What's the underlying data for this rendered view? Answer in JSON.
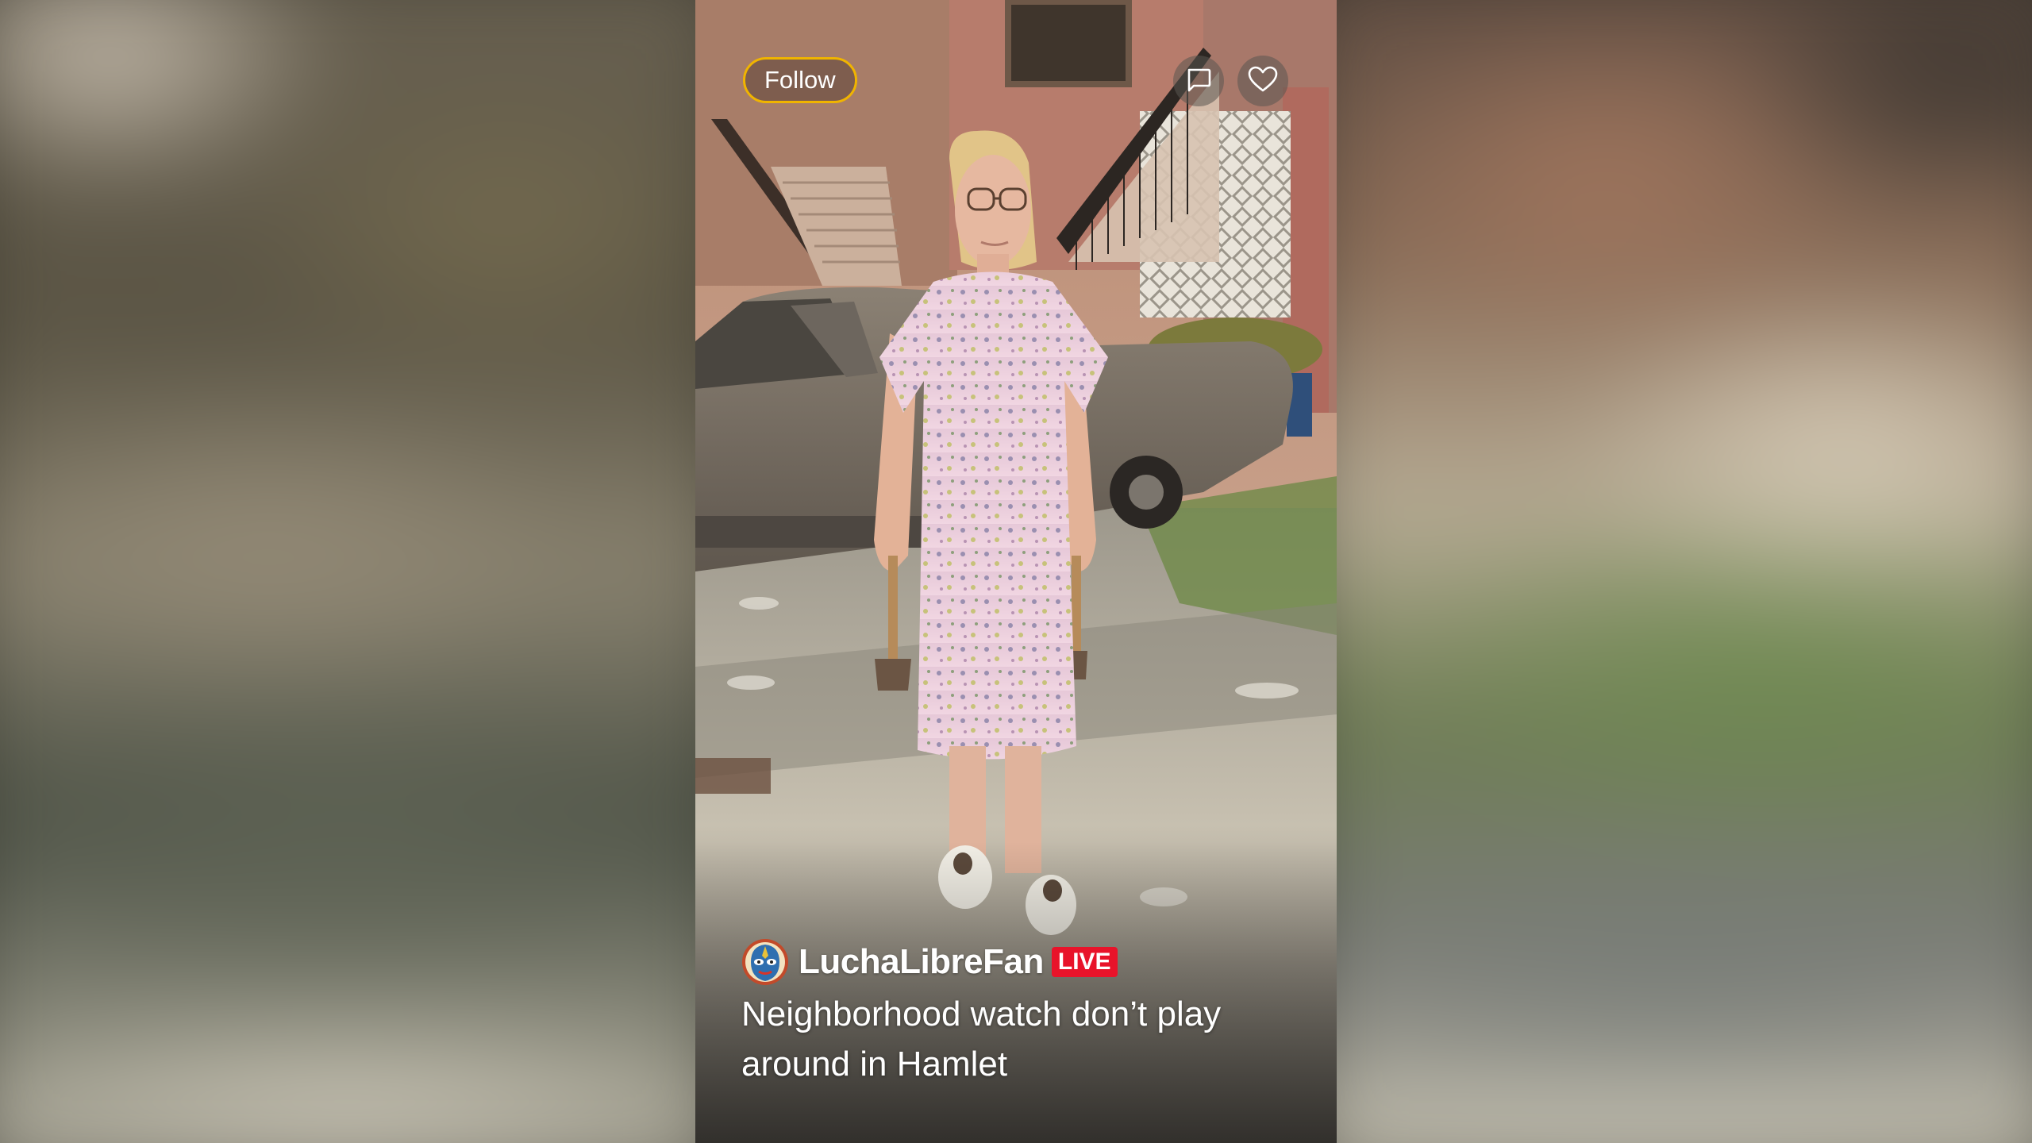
{
  "stream": {
    "follow_label": "Follow",
    "username": "LuchaLibreFan",
    "live_badge": "LIVE",
    "caption": "Neighborhood watch don’t play around in Hamlet"
  },
  "icons": {
    "chat": "chat-bubble-icon",
    "like": "heart-icon",
    "avatar": "luchador-mask-icon"
  },
  "colors": {
    "follow_border": "#f0b400",
    "live_badge": "#e8132a"
  }
}
